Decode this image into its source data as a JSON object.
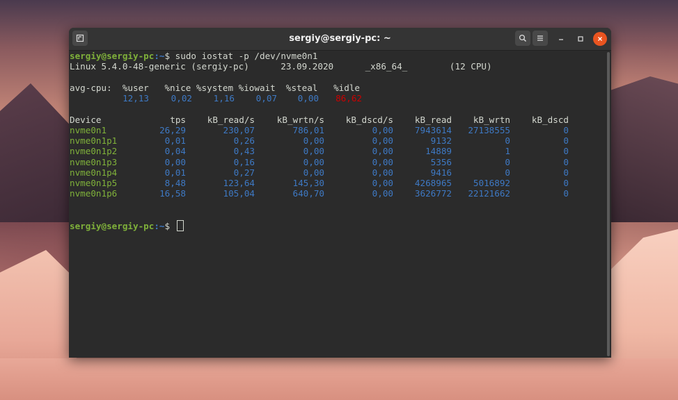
{
  "window": {
    "title": "sergiy@sergiy-pc: ~",
    "new_tab_icon": "terminal-new-tab-icon",
    "search_icon": "search-icon",
    "menu_icon": "hamburger-menu-icon",
    "minimize_icon": "minimize-icon",
    "maximize_icon": "maximize-icon",
    "close_icon": "close-icon",
    "close_color": "#e95420"
  },
  "terminal": {
    "prompt_user": "sergiy@sergiy-pc",
    "prompt_path": ":~",
    "prompt_symbol": "$",
    "command": " sudo iostat -p /dev/nvme0n1",
    "sysinfo": "Linux 5.4.0-48-generic (sergiy-pc)      23.09.2020      _x86_64_        (12 CPU)",
    "cpu_header": "avg-cpu:  %user   %nice %system %iowait  %steal   %idle",
    "cpu_values": {
      "user": "12,13",
      "nice": "0,02",
      "system": "1,16",
      "iowait": "0,07",
      "steal": "0,00",
      "idle": "86,62"
    },
    "device_headers": [
      "Device",
      "tps",
      "kB_read/s",
      "kB_wrtn/s",
      "kB_dscd/s",
      "kB_read",
      "kB_wrtn",
      "kB_dscd"
    ],
    "devices": [
      {
        "name": "nvme0n1",
        "tps": "26,29",
        "read_s": "230,07",
        "wrtn_s": "786,01",
        "dscd_s": "0,00",
        "read": "7943614",
        "wrtn": "27138555",
        "dscd": "0"
      },
      {
        "name": "nvme0n1p1",
        "tps": "0,01",
        "read_s": "0,26",
        "wrtn_s": "0,00",
        "dscd_s": "0,00",
        "read": "9132",
        "wrtn": "0",
        "dscd": "0"
      },
      {
        "name": "nvme0n1p2",
        "tps": "0,04",
        "read_s": "0,43",
        "wrtn_s": "0,00",
        "dscd_s": "0,00",
        "read": "14889",
        "wrtn": "1",
        "dscd": "0"
      },
      {
        "name": "nvme0n1p3",
        "tps": "0,00",
        "read_s": "0,16",
        "wrtn_s": "0,00",
        "dscd_s": "0,00",
        "read": "5356",
        "wrtn": "0",
        "dscd": "0"
      },
      {
        "name": "nvme0n1p4",
        "tps": "0,01",
        "read_s": "0,27",
        "wrtn_s": "0,00",
        "dscd_s": "0,00",
        "read": "9416",
        "wrtn": "0",
        "dscd": "0"
      },
      {
        "name": "nvme0n1p5",
        "tps": "8,48",
        "read_s": "123,64",
        "wrtn_s": "145,30",
        "dscd_s": "0,00",
        "read": "4268965",
        "wrtn": "5016892",
        "dscd": "0"
      },
      {
        "name": "nvme0n1p6",
        "tps": "16,58",
        "read_s": "105,04",
        "wrtn_s": "640,70",
        "dscd_s": "0,00",
        "read": "3626772",
        "wrtn": "22121662",
        "dscd": "0"
      }
    ],
    "colors": {
      "text": "#d3d7cf",
      "green": "#7fb13a",
      "blue": "#3e79c4",
      "red": "#cc0000",
      "background": "#2b2b2b"
    }
  }
}
